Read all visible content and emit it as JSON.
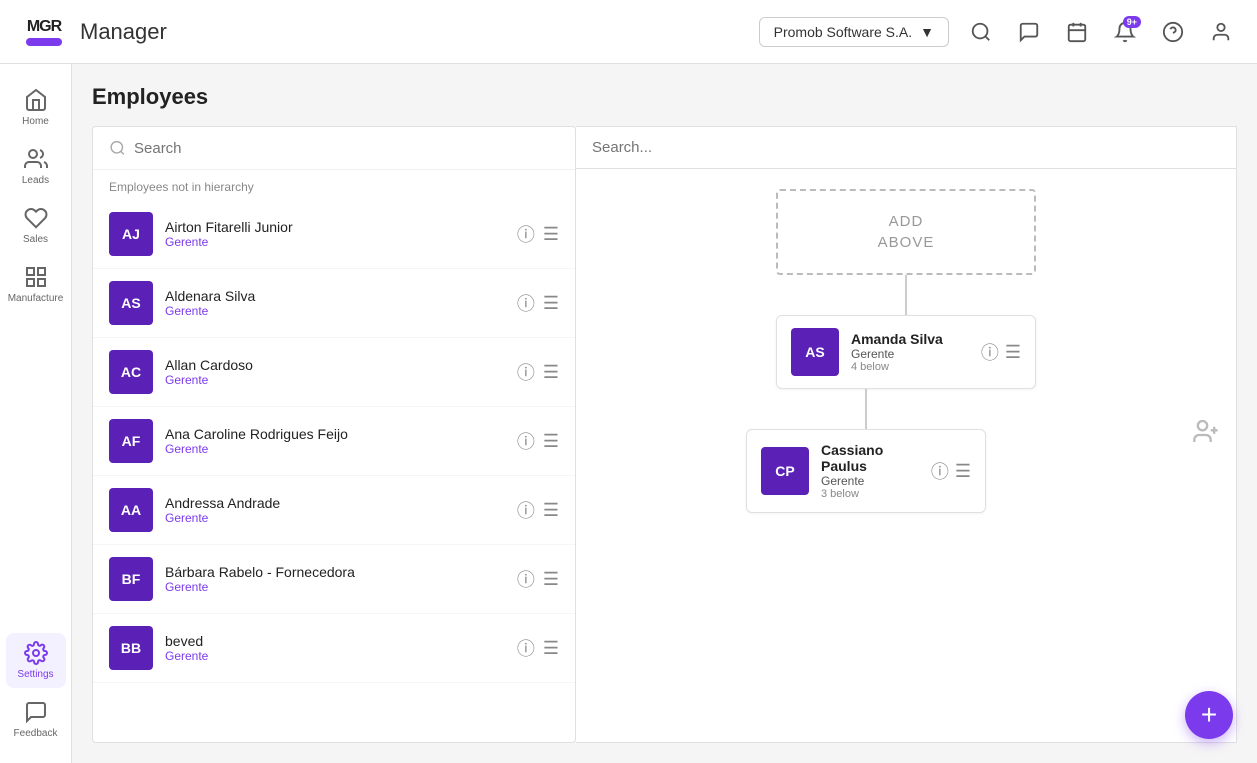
{
  "app": {
    "logo_text": "MGR",
    "title": "Manager",
    "company": "Promob Software S.A.",
    "notifications_badge": "9+"
  },
  "sidebar": {
    "items": [
      {
        "id": "home",
        "label": "Home",
        "icon": "home"
      },
      {
        "id": "leads",
        "label": "Leads",
        "icon": "people"
      },
      {
        "id": "sales",
        "label": "Sales",
        "icon": "handshake"
      },
      {
        "id": "manufacture",
        "label": "Manufacture",
        "icon": "chart-bar"
      },
      {
        "id": "settings",
        "label": "Settings",
        "icon": "gear",
        "active": true
      },
      {
        "id": "feedback",
        "label": "Feedback",
        "icon": "chat"
      }
    ]
  },
  "page": {
    "title": "Employees"
  },
  "left_panel": {
    "search_placeholder": "Search",
    "section_label": "Employees not in hierarchy",
    "employees": [
      {
        "id": "AJ",
        "name": "Airton Fitarelli Junior",
        "role": "Gerente",
        "initials": "AJ"
      },
      {
        "id": "AS1",
        "name": "Aldenara Silva",
        "role": "Gerente",
        "initials": "AS"
      },
      {
        "id": "AC",
        "name": "Allan Cardoso",
        "role": "Gerente",
        "initials": "AC"
      },
      {
        "id": "AF",
        "name": "Ana Caroline Rodrigues Feijo",
        "role": "Gerente",
        "initials": "AF"
      },
      {
        "id": "AA",
        "name": "Andressa Andrade",
        "role": "Gerente",
        "initials": "AA"
      },
      {
        "id": "BF",
        "name": "Bárbara Rabelo - Fornecedora",
        "role": "Gerente",
        "initials": "BF"
      },
      {
        "id": "BB",
        "name": "beved",
        "role": "Gerente",
        "initials": "BB"
      }
    ]
  },
  "right_panel": {
    "search_placeholder": "Search...",
    "add_above_label": "ADD\nABOVE",
    "hierarchy": [
      {
        "initials": "AS",
        "name": "Amanda Silva",
        "role": "Gerente",
        "below": "4 below"
      }
    ],
    "sub_hierarchy": [
      {
        "initials": "CP",
        "name": "Cassiano Paulus",
        "role": "Gerente",
        "below": "3 below"
      }
    ]
  },
  "fab": {
    "label": "+"
  }
}
